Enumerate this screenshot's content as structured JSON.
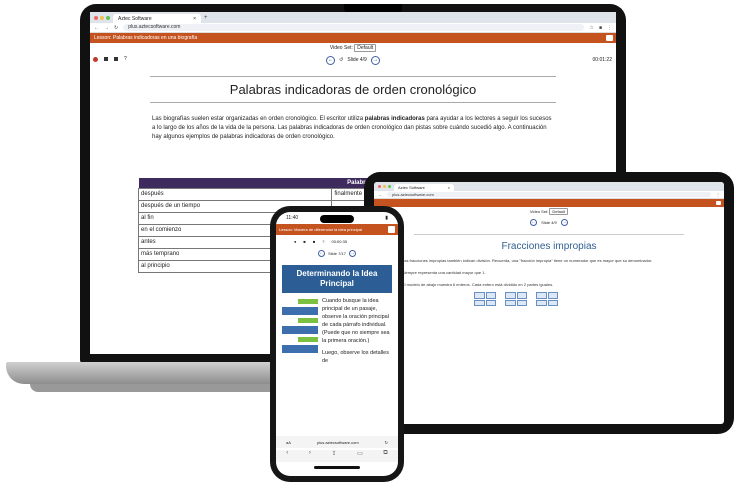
{
  "browser": {
    "tab_title": "Aztec Software",
    "tab_close": "×",
    "new_tab": "+",
    "url": "plus.aztecsoftware.com"
  },
  "laptop": {
    "lesson_bar": "Lesson: Palabras indicadoras en una biografía",
    "video_set_label": "Video Set:",
    "video_set_value": "Default",
    "slide_label": "Slide 4/9",
    "timer": "00:01:22",
    "help": "?",
    "title": "Palabras indicadoras de orden cronológico",
    "paragraph_pre": "Las biografías suelen estar organizadas en orden cronológico. El escritor utiliza ",
    "paragraph_bold": "palabras indicadoras",
    "paragraph_post": " para ayudar a los lectores a seguir los sucesos a lo largo de los años de la vida de la persona. Las palabras indicadoras de orden cronológico dan pistas sobre cuándo sucedió algo. A continuación hay algunos ejemplos de palabras indicadoras de orden cronológico.",
    "table_header": "Palabras indicadoras de o",
    "table_rows": [
      [
        "después",
        "finalmente"
      ],
      [
        "después de un tiempo",
        ""
      ],
      [
        "al fin",
        ""
      ],
      [
        "en el comienzo",
        ""
      ],
      [
        "antes",
        ""
      ],
      [
        "más temprano",
        ""
      ],
      [
        "al principio",
        ""
      ]
    ]
  },
  "tablet": {
    "title": "Fracciones impropias",
    "p1": "Las fracciones impropias también indican división. Recuerda, una \"fracción impropia\" tiene un numerador que es mayor que su denominador.",
    "p2": "Siempre representa una cantidad mayor que 1.",
    "p3": "El modelo de abajo muestra 6 enteros. Cada entero está dividido en 2 partes iguales.",
    "video_set_label": "Video Set:",
    "video_set_value": "Default",
    "slide_label": "Slide 4/9"
  },
  "phone": {
    "clock": "11:40",
    "lesson_bar": "Lesson: Manera de diferenciar la idea principal",
    "timer": "00:00:35",
    "slide_label": "Slide 7/17",
    "heading": "Determinando la Idea Principal",
    "body": "Cuando busque la idea principal de un pasaje, observe la oración principal de cada párrafo individual. (Puede que no siempre sea la primera oración.)",
    "body2": "Luego, observe los detalles de",
    "aa": "aA",
    "url": "plus.aztecsoftware.com"
  }
}
